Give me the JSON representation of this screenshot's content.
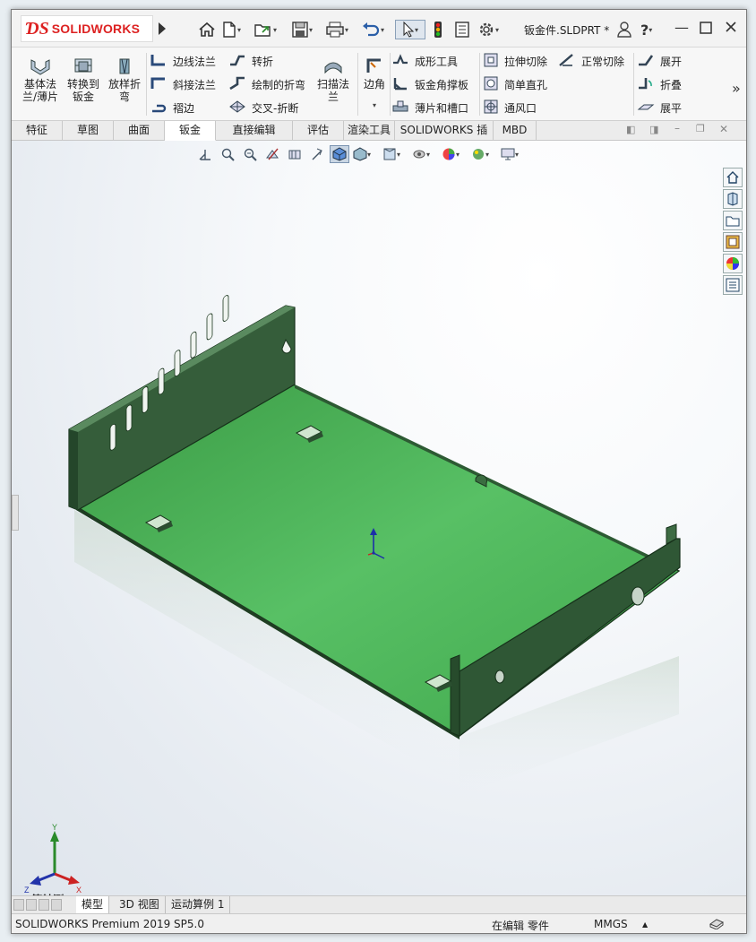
{
  "app": {
    "logo_text": "SOLIDWORKS",
    "document_title": "钣金件.SLDPRT *"
  },
  "ribbon": {
    "big_buttons": [
      {
        "label_line1": "基体法",
        "label_line2": "兰/薄片"
      },
      {
        "label_line1": "转换到",
        "label_line2": "钣金"
      },
      {
        "label_line1": "放样折",
        "label_line2": "弯"
      }
    ],
    "col1": [
      "边线法兰",
      "斜接法兰",
      "褶边"
    ],
    "col2": [
      "转折",
      "绘制的折弯",
      "交叉-折断"
    ],
    "sweep_flange": {
      "label_line1": "扫描法",
      "label_line2": "兰"
    },
    "corner": "边角",
    "col3": [
      "成形工具",
      "钣金角撑板",
      "薄片和槽口"
    ],
    "col4": [
      "拉伸切除",
      "简单直孔",
      "通风口"
    ],
    "normal_cut": "正常切除",
    "col5": [
      "展开",
      "折叠",
      "展平"
    ],
    "more": "»"
  },
  "tabs": [
    "特征",
    "草图",
    "曲面",
    "钣金",
    "直接编辑",
    "评估",
    "渲染工具",
    "SOLIDWORKS 插件",
    "MBD"
  ],
  "active_tab": "钣金",
  "viewport": {
    "view_name": "*等轴测",
    "triad_labels": {
      "x": "X",
      "y": "Y",
      "z": "Z"
    },
    "model_color": "#3fae4c"
  },
  "bottom_tabs": [
    "模型",
    "3D 视图",
    "运动算例 1"
  ],
  "status_bar": {
    "product": "SOLIDWORKS Premium 2019 SP5.0",
    "mode": "在编辑 零件",
    "units": "MMGS",
    "units_arrow": "▲"
  }
}
